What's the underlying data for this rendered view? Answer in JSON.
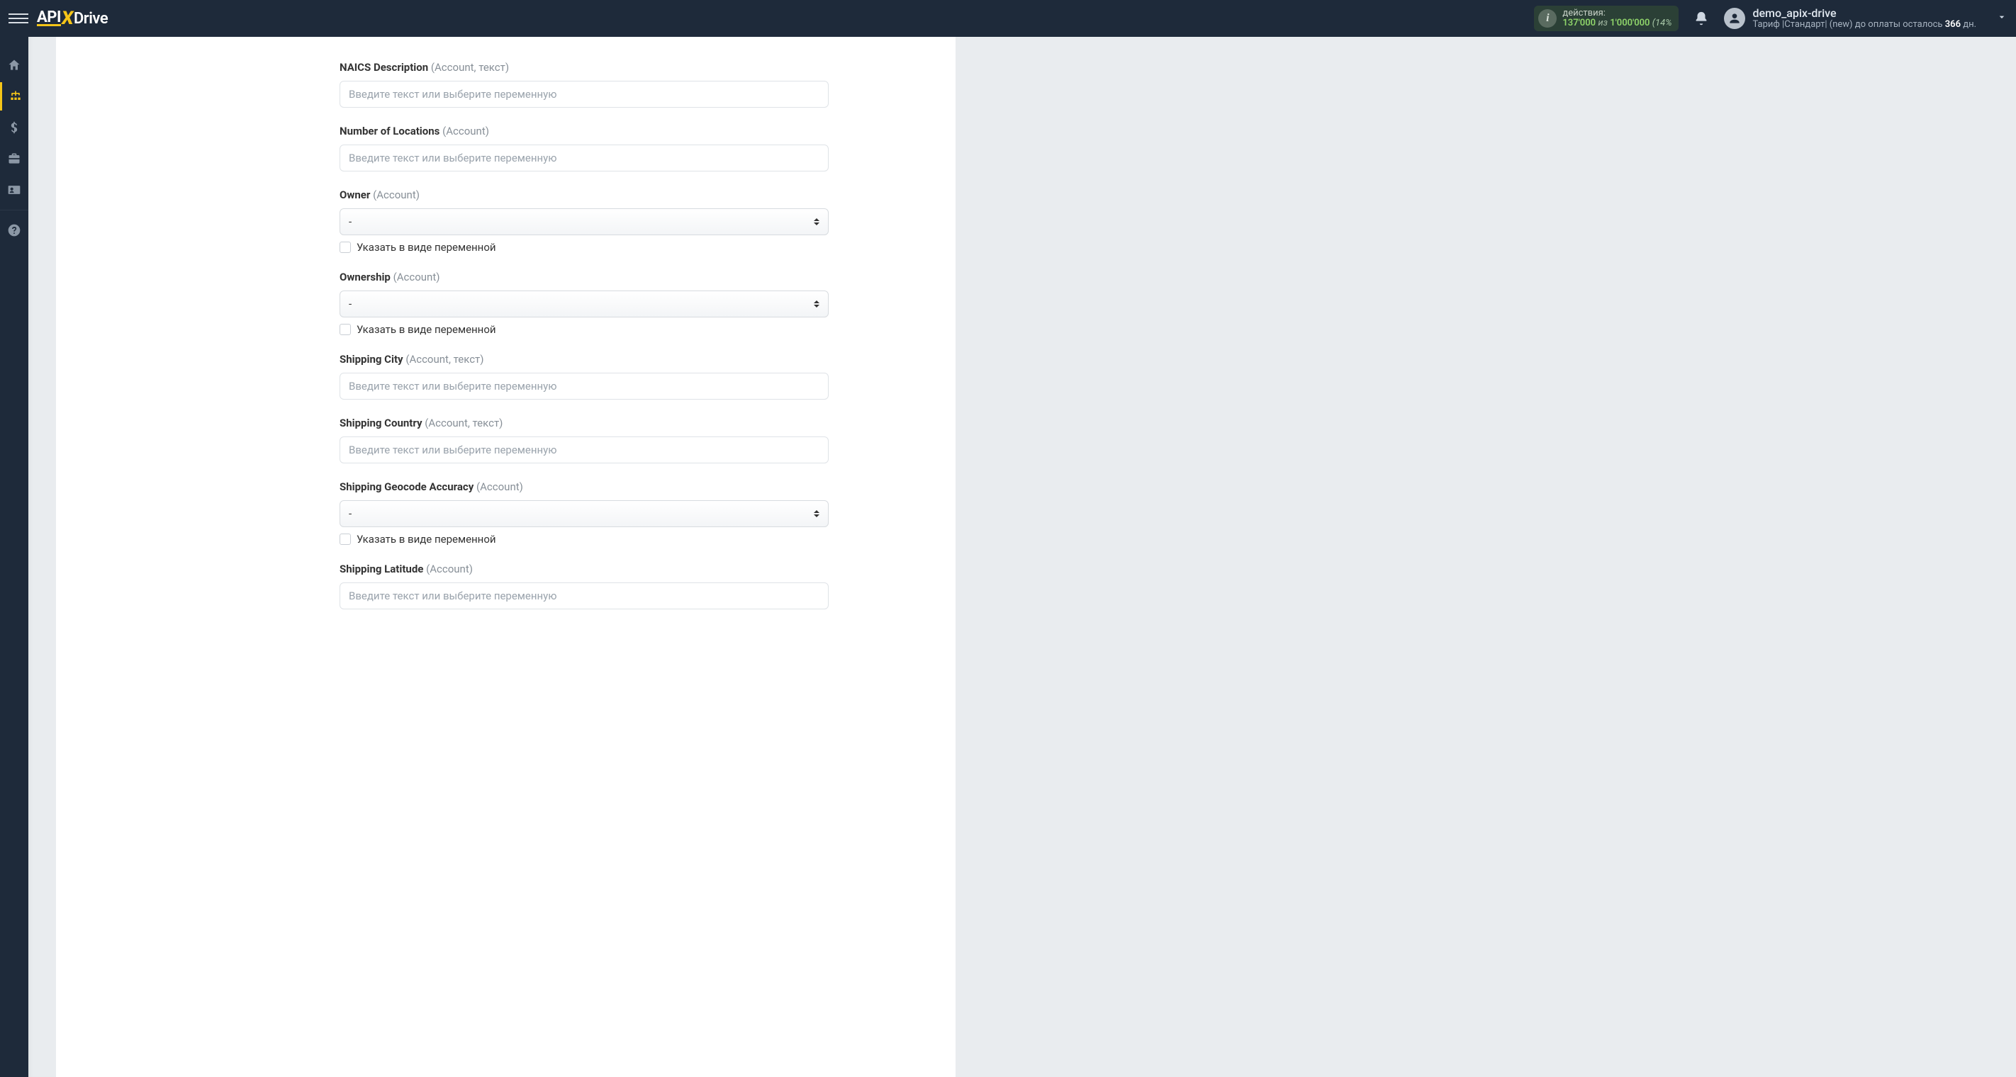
{
  "top": {
    "logo": {
      "api": "API",
      "x": "X",
      "drive": "Drive"
    },
    "actions": {
      "label": "действия:",
      "n1": "137'000",
      "iz": "из",
      "n2": "1'000'000",
      "pct": "(14%"
    },
    "user": {
      "name": "demo_apix-drive",
      "plan_prefix": "Тариф |Стандарт| (new) до оплаты осталось ",
      "plan_days": "366",
      "plan_suffix": " дн."
    }
  },
  "form": {
    "placeholder_text": "Введите текст или выберите переменную",
    "select_default": "-",
    "checkbox_label": "Указать в виде переменной",
    "fields": {
      "naics_desc": {
        "label": "NAICS Description",
        "hint": "(Account, текст)"
      },
      "num_locations": {
        "label": "Number of Locations",
        "hint": "(Account)"
      },
      "owner": {
        "label": "Owner",
        "hint": "(Account)"
      },
      "ownership": {
        "label": "Ownership",
        "hint": "(Account)"
      },
      "shipping_city": {
        "label": "Shipping City",
        "hint": "(Account, текст)"
      },
      "shipping_country": {
        "label": "Shipping Country",
        "hint": "(Account, текст)"
      },
      "shipping_geocode": {
        "label": "Shipping Geocode Accuracy",
        "hint": "(Account)"
      },
      "shipping_latitude": {
        "label": "Shipping Latitude",
        "hint": "(Account)"
      }
    }
  }
}
